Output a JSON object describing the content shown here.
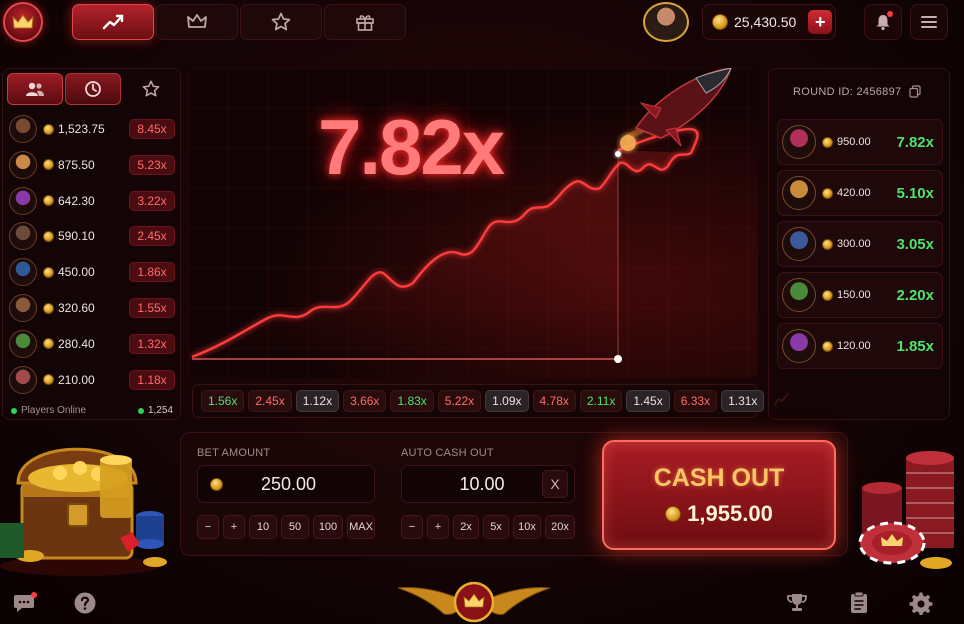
{
  "nav": {
    "tabs": [
      {
        "name": "crash-graph",
        "icon": "trending-up-icon",
        "active": true
      },
      {
        "name": "crown",
        "icon": "crown-icon",
        "active": false
      },
      {
        "name": "favorites",
        "icon": "star-icon",
        "active": false
      },
      {
        "name": "gifts",
        "icon": "gift-icon",
        "active": false
      }
    ]
  },
  "user": {
    "balance": "25,430.50"
  },
  "players": {
    "rows": [
      {
        "amount": "1,523.75",
        "mult": "8.45x",
        "color": "#7a4a30"
      },
      {
        "amount": "875.50",
        "mult": "5.23x",
        "color": "#c98a4a"
      },
      {
        "amount": "642.30",
        "mult": "3.22x",
        "color": "#8a3aa8"
      },
      {
        "amount": "590.10",
        "mult": "2.45x",
        "color": "#6b4a3a"
      },
      {
        "amount": "450.00",
        "mult": "1.86x",
        "color": "#2f5a9a"
      },
      {
        "amount": "320.60",
        "mult": "1.55x",
        "color": "#8a5a3a"
      },
      {
        "amount": "280.40",
        "mult": "1.32x",
        "color": "#4a8a3a"
      },
      {
        "amount": "210.00",
        "mult": "1.18x",
        "color": "#a04a4a"
      }
    ],
    "online_label": "Players Online",
    "online_count": "1,254"
  },
  "game": {
    "multiplier": "7.82x"
  },
  "history": [
    {
      "value": "1.56x",
      "tone": "green"
    },
    {
      "value": "2.45x",
      "tone": "red"
    },
    {
      "value": "1.12x",
      "tone": "white"
    },
    {
      "value": "3.66x",
      "tone": "red"
    },
    {
      "value": "1.83x",
      "tone": "green"
    },
    {
      "value": "5.22x",
      "tone": "red"
    },
    {
      "value": "1.09x",
      "tone": "white"
    },
    {
      "value": "4.78x",
      "tone": "red"
    },
    {
      "value": "2.11x",
      "tone": "green"
    },
    {
      "value": "1.45x",
      "tone": "white"
    },
    {
      "value": "6.33x",
      "tone": "red"
    },
    {
      "value": "1.31x",
      "tone": "white"
    }
  ],
  "round": {
    "label": "ROUND ID: 2456897"
  },
  "winners": [
    {
      "amount": "950.00",
      "mult": "7.82x",
      "color": "#b0305a"
    },
    {
      "amount": "420.00",
      "mult": "5.10x",
      "color": "#c98a3a"
    },
    {
      "amount": "300.00",
      "mult": "3.05x",
      "color": "#3a5a9a"
    },
    {
      "amount": "150.00",
      "mult": "2.20x",
      "color": "#4a8a3a"
    },
    {
      "amount": "120.00",
      "mult": "1.85x",
      "color": "#8a3aa8"
    }
  ],
  "bet": {
    "label": "BET AMOUNT",
    "value": "250.00",
    "minus": "−",
    "plus": "+",
    "quick": [
      "10",
      "50",
      "100",
      "MAX"
    ]
  },
  "auto": {
    "label": "AUTO CASH OUT",
    "value": "10.00",
    "clear": "X",
    "minus": "−",
    "plus": "+",
    "quick": [
      "2x",
      "5x",
      "10x",
      "20x"
    ]
  },
  "cashout": {
    "label": "CASH OUT",
    "amount": "1,955.00"
  },
  "colors": {
    "accent": "#d02b33",
    "win": "#4fe26d",
    "loss": "#ff6b6b",
    "gold": "#ffc46a"
  }
}
